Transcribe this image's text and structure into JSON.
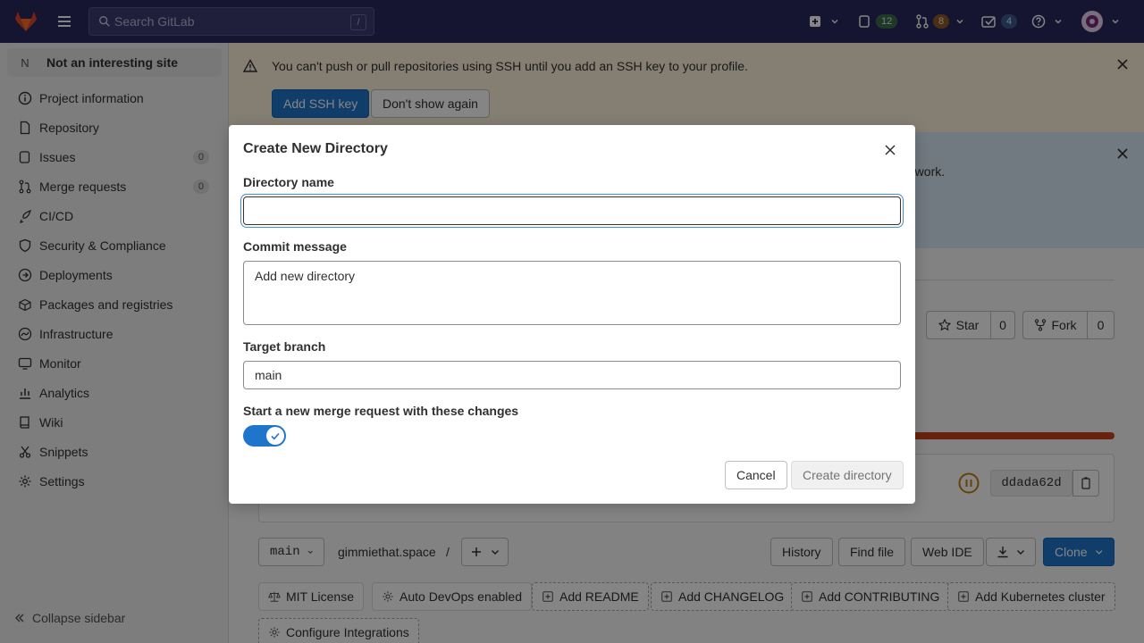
{
  "topbar": {
    "search_placeholder": "Search GitLab",
    "search_shortcut": "/",
    "issues_count": "12",
    "merge_requests_count": "8",
    "todos_count": "4"
  },
  "sidebar": {
    "project_initial": "N",
    "project_name": "Not an interesting site",
    "items": [
      {
        "label": "Project information",
        "icon": "info-icon"
      },
      {
        "label": "Repository",
        "icon": "doc-icon"
      },
      {
        "label": "Issues",
        "icon": "issues-icon",
        "count": "0"
      },
      {
        "label": "Merge requests",
        "icon": "merge-request-icon",
        "count": "0"
      },
      {
        "label": "CI/CD",
        "icon": "rocket-icon"
      },
      {
        "label": "Security & Compliance",
        "icon": "shield-icon"
      },
      {
        "label": "Deployments",
        "icon": "deployments-icon"
      },
      {
        "label": "Packages and registries",
        "icon": "package-icon"
      },
      {
        "label": "Infrastructure",
        "icon": "cloud-icon"
      },
      {
        "label": "Monitor",
        "icon": "monitor-icon"
      },
      {
        "label": "Analytics",
        "icon": "chart-icon"
      },
      {
        "label": "Wiki",
        "icon": "book-icon"
      },
      {
        "label": "Snippets",
        "icon": "snippet-icon"
      },
      {
        "label": "Settings",
        "icon": "gear-icon"
      }
    ],
    "collapse_label": "Collapse sidebar"
  },
  "ssh_alert": {
    "message": "You can't push or pull repositories using SSH until you add an SSH key to your profile.",
    "add_key_label": "Add SSH key",
    "dont_show_label": "Don't show again"
  },
  "info_alert": {
    "message_fragment": "o work."
  },
  "project_actions": {
    "star_label": "Star",
    "star_count": "0",
    "fork_label": "Fork",
    "fork_count": "0"
  },
  "commit": {
    "sha": "ddada62d"
  },
  "repo_toolbar": {
    "branch": "main",
    "path": "gimmiethat.space",
    "path_separator": "/",
    "history_label": "History",
    "find_file_label": "Find file",
    "web_ide_label": "Web IDE",
    "clone_label": "Clone"
  },
  "shortcuts": [
    {
      "label": "MIT License",
      "icon": "scale-icon"
    },
    {
      "label": "Auto DevOps enabled",
      "icon": "settings-icon"
    },
    {
      "label": "Add README",
      "icon": "plus-square-icon"
    },
    {
      "label": "Add CHANGELOG",
      "icon": "plus-square-icon"
    },
    {
      "label": "Add CONTRIBUTING",
      "icon": "plus-square-icon"
    },
    {
      "label": "Add Kubernetes cluster",
      "icon": "plus-square-icon"
    },
    {
      "label": "Configure Integrations",
      "icon": "settings-icon"
    }
  ],
  "modal": {
    "title": "Create New Directory",
    "directory_name_label": "Directory name",
    "directory_name_value": "",
    "commit_message_label": "Commit message",
    "commit_message_value": "Add new directory",
    "target_branch_label": "Target branch",
    "target_branch_value": "main",
    "merge_request_label": "Start a new merge request with these changes",
    "merge_request_enabled": true,
    "cancel_label": "Cancel",
    "create_label": "Create directory"
  },
  "colors": {
    "topbar": "#292961",
    "primary": "#1f75cb",
    "pipeline_failed": "#c6431e"
  }
}
